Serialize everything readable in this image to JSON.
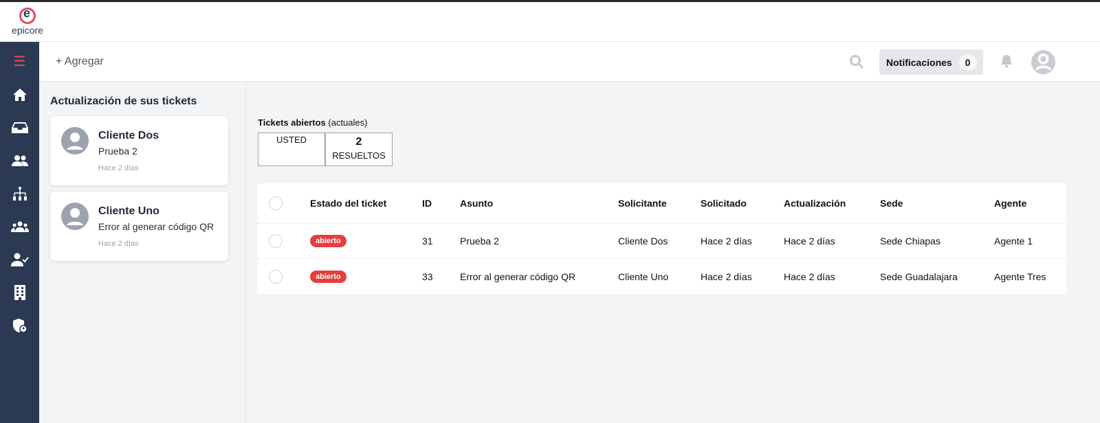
{
  "brand": {
    "name": "epicore",
    "accent": "#e24b5b",
    "sidebar_color": "#2b3a52"
  },
  "sidebar": {
    "items": [
      {
        "icon": "list-icon"
      },
      {
        "icon": "home-icon"
      },
      {
        "icon": "inbox-icon"
      },
      {
        "icon": "users-icon"
      },
      {
        "icon": "org-chart-icon"
      },
      {
        "icon": "group-icon"
      },
      {
        "icon": "user-check-icon"
      },
      {
        "icon": "building-icon"
      },
      {
        "icon": "shield-user-icon"
      }
    ]
  },
  "topbar": {
    "add_label": "+ Agregar",
    "notifications_label": "Notificaciones",
    "notifications_count": "0"
  },
  "updates": {
    "title": "Actualización de sus tickets",
    "cards": [
      {
        "name": "Cliente Dos",
        "subject": "Prueba 2",
        "time": "Hace 2 días"
      },
      {
        "name": "Cliente Uno",
        "subject": "Error al generar código QR",
        "time": "Hace 2 días"
      }
    ]
  },
  "open_tickets": {
    "title": "Tickets abiertos",
    "subtitle": "(actuales)",
    "boxes": [
      {
        "value": "",
        "label": "USTED"
      },
      {
        "value": "2",
        "label": "RESUELTOS"
      }
    ]
  },
  "table": {
    "headers": [
      "Estado del ticket",
      "ID",
      "Asunto",
      "Solicitante",
      "Solicitado",
      "Actualización",
      "Sede",
      "Agente"
    ],
    "rows": [
      [
        "abierto",
        "31",
        "Prueba 2",
        "Cliente Dos",
        "Hace 2 días",
        "Hace 2 días",
        "Sede Chiapas",
        "Agente 1"
      ],
      [
        "abierto",
        "33",
        "Error al generar código QR",
        "Cliente Uno",
        "Hace 2 días",
        "Hace 2 días",
        "Sede Guadalajara",
        "Agente Tres"
      ]
    ]
  }
}
